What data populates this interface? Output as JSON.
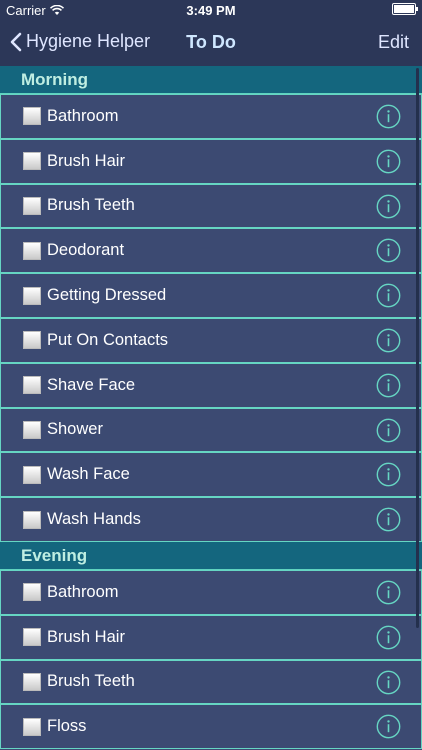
{
  "status": {
    "carrier": "Carrier",
    "time": "3:49 PM"
  },
  "nav": {
    "back_label": "Hygiene Helper",
    "title": "To Do",
    "edit_label": "Edit"
  },
  "sections": [
    {
      "title": "Morning",
      "items": [
        "Bathroom",
        "Brush Hair",
        "Brush Teeth",
        "Deodorant",
        "Getting Dressed",
        "Put On Contacts",
        "Shave Face",
        "Shower",
        "Wash Face",
        "Wash Hands"
      ]
    },
    {
      "title": "Evening",
      "items": [
        "Bathroom",
        "Brush Hair",
        "Brush Teeth",
        "Floss"
      ]
    }
  ],
  "colors": {
    "accent": "#66d6c3",
    "header_bg": "#14667e",
    "row_bg": "#3c4a72",
    "bar_bg": "#2c3758"
  },
  "icons": {
    "back": "chevron-left-icon",
    "info": "info-circle-icon",
    "wifi": "wifi-icon",
    "battery": "battery-icon"
  }
}
